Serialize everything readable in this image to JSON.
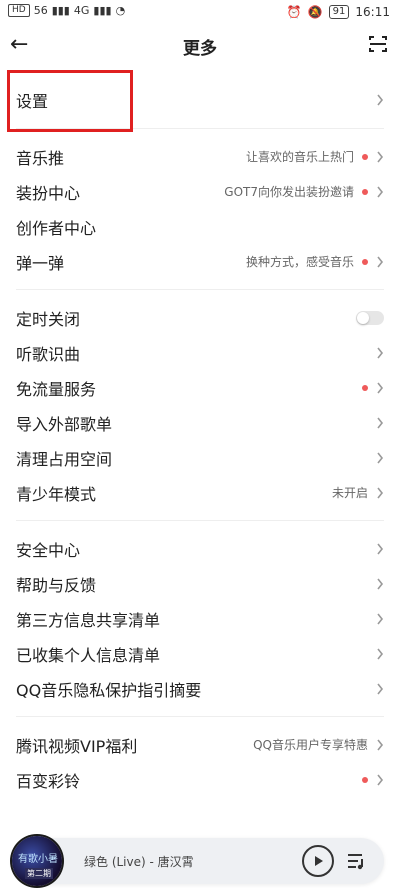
{
  "status_bar": {
    "left_badges": [
      "HD",
      "HD"
    ],
    "signal_left": "56",
    "signal_right": "4G",
    "battery": "91",
    "time": "16:11"
  },
  "header": {
    "title": "更多"
  },
  "groups": [
    {
      "rows": [
        {
          "label": "设置",
          "sub": "",
          "dot": false,
          "chevron": true
        }
      ]
    },
    {
      "rows": [
        {
          "label": "音乐推",
          "sub": "让喜欢的音乐上热门",
          "dot": true,
          "chevron": true
        },
        {
          "label": "装扮中心",
          "sub": "GOT7向你发出装扮邀请",
          "dot": true,
          "chevron": true
        },
        {
          "label": "创作者中心",
          "sub": "",
          "dot": false,
          "chevron": false
        },
        {
          "label": "弹一弹",
          "sub": "换种方式，感受音乐",
          "dot": true,
          "chevron": true
        }
      ]
    },
    {
      "rows": [
        {
          "label": "定时关闭",
          "sub": "",
          "dot": false,
          "chevron": false,
          "toggle": true
        },
        {
          "label": "听歌识曲",
          "sub": "",
          "dot": false,
          "chevron": true
        },
        {
          "label": "免流量服务",
          "sub": "",
          "dot": true,
          "chevron": true
        },
        {
          "label": "导入外部歌单",
          "sub": "",
          "dot": false,
          "chevron": true
        },
        {
          "label": "清理占用空间",
          "sub": "",
          "dot": false,
          "chevron": true
        },
        {
          "label": "青少年模式",
          "sub": "未开启",
          "dot": false,
          "chevron": true
        }
      ]
    },
    {
      "rows": [
        {
          "label": "安全中心",
          "sub": "",
          "dot": false,
          "chevron": true
        },
        {
          "label": "帮助与反馈",
          "sub": "",
          "dot": false,
          "chevron": true
        },
        {
          "label": "第三方信息共享清单",
          "sub": "",
          "dot": false,
          "chevron": true
        },
        {
          "label": "已收集个人信息清单",
          "sub": "",
          "dot": false,
          "chevron": true
        },
        {
          "label": "QQ音乐隐私保护指引摘要",
          "sub": "",
          "dot": false,
          "chevron": true
        }
      ]
    },
    {
      "rows": [
        {
          "label": "腾讯视频VIP福利",
          "sub": "QQ音乐用户专享特惠",
          "dot": false,
          "chevron": true
        },
        {
          "label": "百变彩铃",
          "sub": "",
          "dot": true,
          "chevron": true
        }
      ]
    }
  ],
  "player": {
    "cover_text_1": "有歌小暑",
    "cover_text_2": "第二期",
    "song": "绿色 (Live) - 唐汉霄"
  },
  "colors": {
    "accent_dot": "#ef5a5a",
    "highlight_box": "#e02020"
  }
}
